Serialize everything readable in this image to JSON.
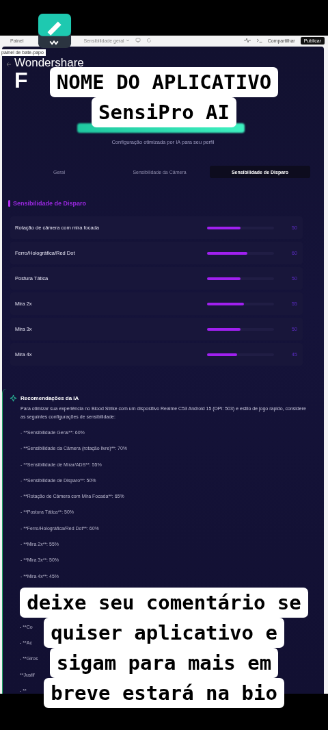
{
  "toolbar": {
    "left_label": "Painel",
    "dropdown": "Sensibilidade geral",
    "share": "Compartilhar",
    "publish": "Publicar"
  },
  "chat_panel_label": "painel de bate-papo",
  "heading": [
    "Wondershare",
    "F"
  ],
  "subtitle": "Configuração otimizada por IA para seu perfil",
  "tabs": [
    {
      "label": "Geral",
      "selected": false
    },
    {
      "label": "Sensibilidade da Câmera",
      "selected": false
    },
    {
      "label": "Sensibilidade de Disparo",
      "selected": true
    }
  ],
  "section_title": "Sensibilidade de Disparo",
  "settings": [
    {
      "label": "Rotação de câmera com mira focada",
      "level": 0.5,
      "value": "50"
    },
    {
      "label": "Ferro/Holográfica/Red Dot",
      "level": 0.6,
      "value": "60"
    },
    {
      "label": "Postura Tática",
      "level": 0.5,
      "value": "50"
    },
    {
      "label": "Mira 2x",
      "level": 0.55,
      "value": "55"
    },
    {
      "label": "Mira 3x",
      "level": 0.5,
      "value": "50"
    },
    {
      "label": "Mira 4x",
      "level": 0.45,
      "value": "45"
    }
  ],
  "recommendations": {
    "title": "Recomendações da IA",
    "intro": "Para otimizar sua experiência no Blood Strike com um dispositivo Realme C53 Android 15 (DPI: 503) e estilo de jogo rapido, considere as seguintes configurações de sensibilidade:",
    "items": [
      "- **Sensibilidade Geral**: 60%",
      "- **Sensibilidade da Câmera (rotação livre)**: 70%",
      "- **Sensibilidade de Mirar/ADS**: 55%",
      "- **Sensibilidade de Disparo**: 50%",
      "- **Rotação de Câmera com Mira Focada**: 65%",
      "- **Postura Tática**: 50%",
      "- **Ferro/Holográfica/Red Dot**: 60%",
      "- **Mira 2x**: 55%",
      "- **Mira 3x**: 50%",
      "- **Mira 4x**: 45%"
    ],
    "hidden_items": [
      "- **Co",
      "- **Ac",
      "- **Giros",
      "**Justif",
      "- **"
    ]
  },
  "captions": [
    {
      "lines": [
        "NOME DO APLICATIVO",
        "SensiPro AI"
      ]
    },
    {
      "lines": [
        "deixe seu comentário se",
        "quiser aplicativo e",
        "sigam para mais em",
        "breve estará na bio"
      ]
    }
  ]
}
